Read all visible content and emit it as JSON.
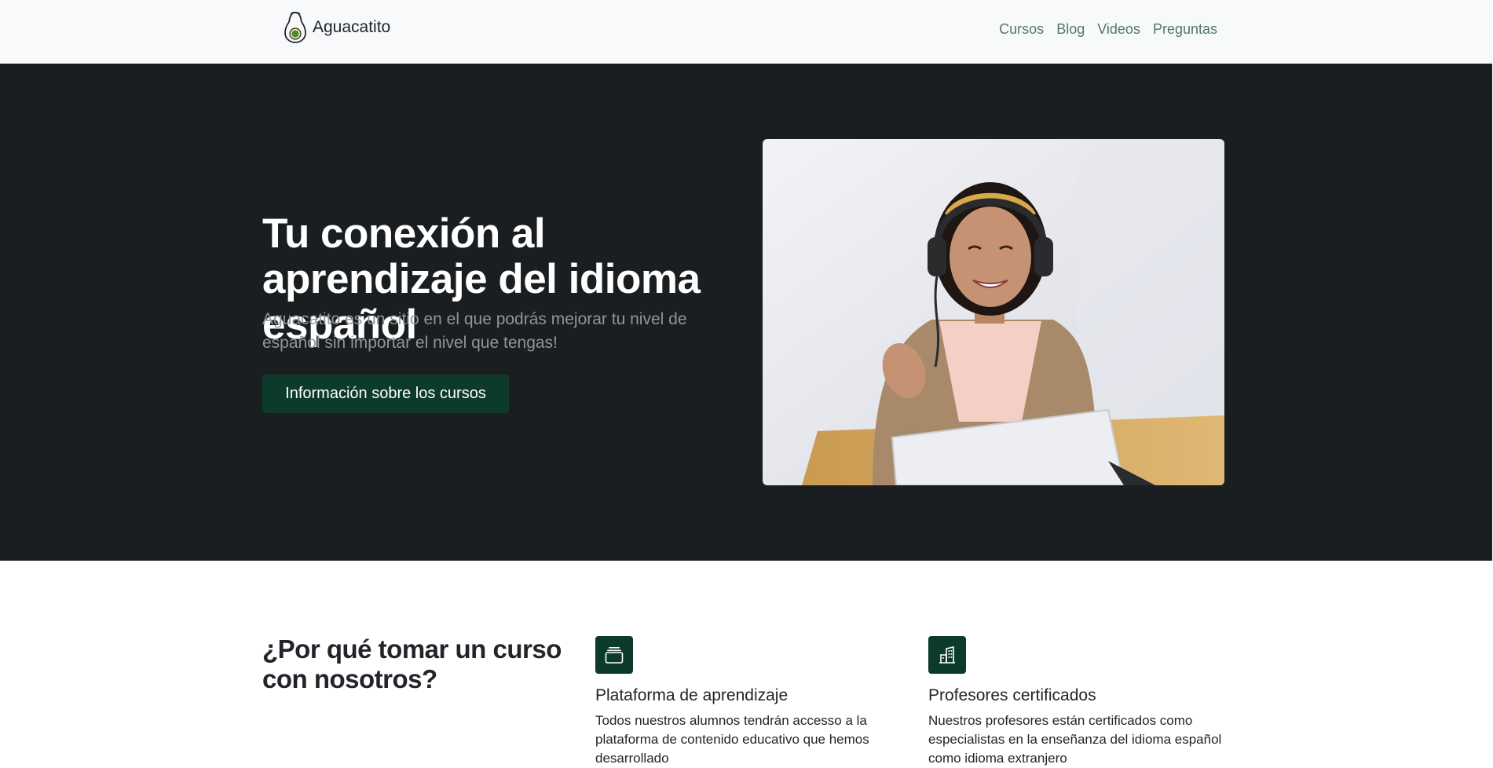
{
  "navbar": {
    "brand": "Aguacatito",
    "links": [
      "Cursos",
      "Blog",
      "Videos",
      "Preguntas"
    ]
  },
  "hero": {
    "title": "Tu conexión al aprendizaje del idioma español",
    "lead": "Aguacatito es un sitio en el que podrás mejorar tu nivel de español sin importar el nivel que tengas!",
    "button_label": "Información sobre los cursos",
    "image_icon": "person-with-headphones-photo"
  },
  "features": {
    "title": "¿Por qué tomar un curso con nosotros?",
    "items": [
      {
        "icon": "collection-icon",
        "title": "Plataforma de aprendizaje",
        "text": "Todos nuestros alumnos tendrán accesso a la plataforma de contenido educativo que hemos desarrollado"
      },
      {
        "icon": "building-icon",
        "title": "Profesores certificados",
        "text": "Nuestros profesores están certificados como especialistas en la enseñanza del idioma español como idioma extranjero"
      }
    ]
  },
  "colors": {
    "navbar_bg": "#f8f9fa",
    "nav_link": "#4f7a65",
    "hero_bg": "#1b1e21",
    "accent": "#0c3a2b"
  }
}
